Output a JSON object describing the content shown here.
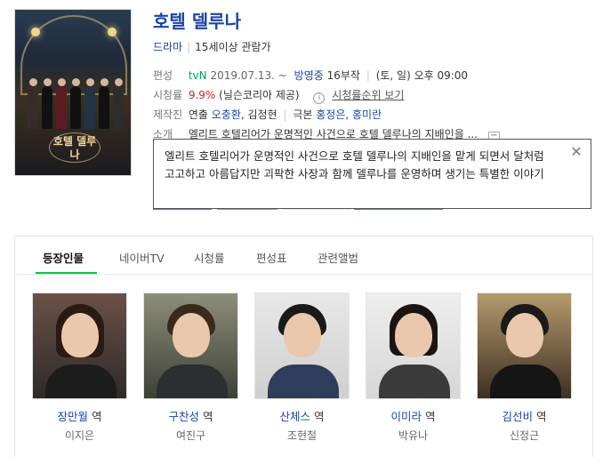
{
  "show": {
    "title": "호텔 델루나",
    "genre": "드라마",
    "rating": "15세이상 관람가",
    "poster_logo": "호텔 델루나"
  },
  "schedule": {
    "label": "편성",
    "channel": "tvN",
    "date": "2019.07.13. ~",
    "status": "방영중",
    "episodes": "16부작",
    "airtime": "(토, 일) 오후 09:00"
  },
  "ratings": {
    "label": "시청률",
    "value": "9.9%",
    "source": "(닐슨코리아 제공)",
    "info_icon": "i",
    "link": "시청률순위 보기"
  },
  "production": {
    "label": "제작진",
    "director_label": "연출",
    "director": "오충환",
    "director2": "김정현",
    "writer_label": "극본",
    "writers": "홍정은, 홍미란"
  },
  "synopsis": {
    "label": "소개",
    "short": "엘리트 호텔리어가 운명적인 사건으로 호텔 델루나의 지배인을",
    "toggle": "−",
    "full": "엘리트 호텔리어가 운명적인 사건으로 호텔 델루나의 지배인을 맡게 되면서 달처럼 고고하고 아름답지만 괴팍한 사장과 함께 델루나를 운영하며 생기는 특별한 이야기",
    "close": "✕"
  },
  "tabs": [
    {
      "label": "등장인물"
    },
    {
      "label": "네이버TV"
    },
    {
      "label": "시청률"
    },
    {
      "label": "편성표"
    },
    {
      "label": "관련앨범"
    }
  ],
  "cast": [
    {
      "role": "장만월",
      "suffix": " 역",
      "actor": "이지은"
    },
    {
      "role": "구찬성",
      "suffix": " 역",
      "actor": "여진구"
    },
    {
      "role": "산체스",
      "suffix": " 역",
      "actor": "조현철"
    },
    {
      "role": "이미라",
      "suffix": " 역",
      "actor": "박유나"
    },
    {
      "role": "김선비",
      "suffix": " 역",
      "actor": "신정근"
    }
  ],
  "colors": {
    "link_blue": "#1a44a8",
    "status_green": "#00a05a",
    "rating_red": "#d2222d",
    "tab_accent": "#00c73c"
  }
}
